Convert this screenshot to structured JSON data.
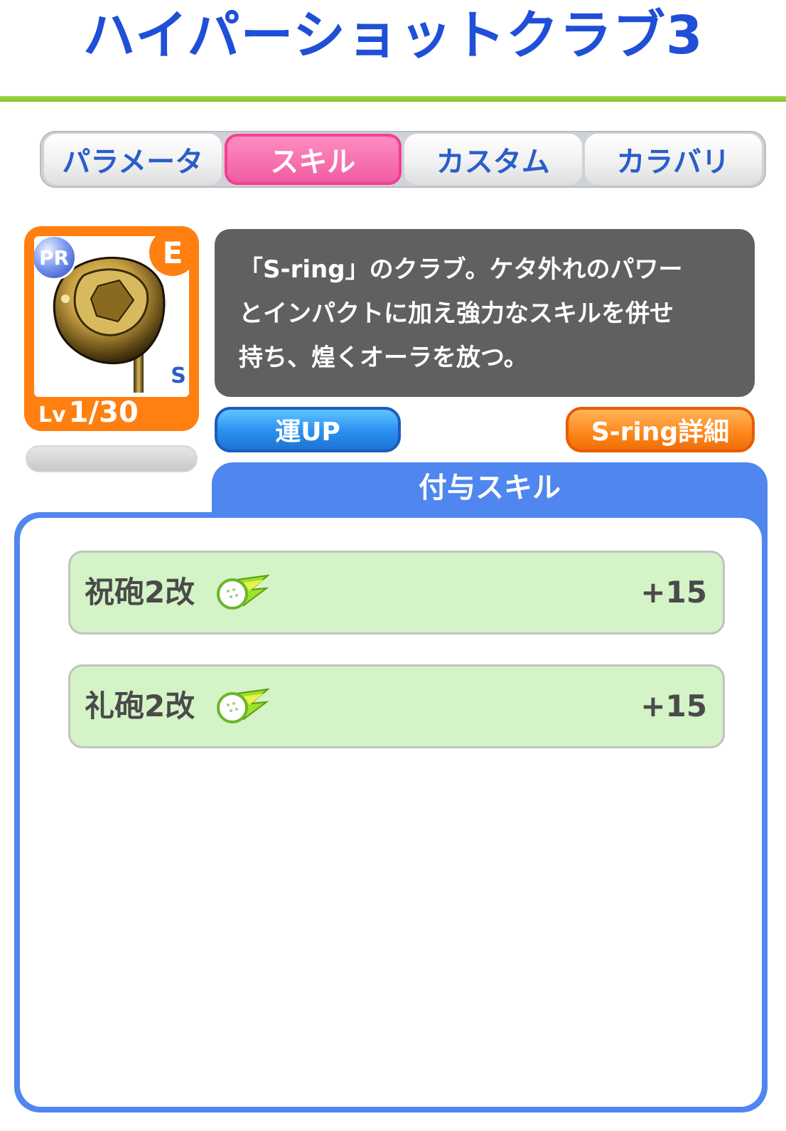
{
  "title": "ハイパーショットクラブ3",
  "tabs": [
    {
      "label": "パラメータ",
      "active": false
    },
    {
      "label": "スキル",
      "active": true
    },
    {
      "label": "カスタム",
      "active": false
    },
    {
      "label": "カラバリ",
      "active": false
    }
  ],
  "item": {
    "rarity_badge": "PR",
    "grade": "E",
    "level_prefix": "Lv",
    "level": "1/30",
    "brand_mark": "S"
  },
  "description": {
    "line1": "「S-ring」のクラブ。ケタ外れのパワー",
    "line2": "とインパクトに加え強力なスキルを併せ",
    "line3": "持ち、煌くオーラを放つ。"
  },
  "buttons": {
    "luck_up": "運UP",
    "sring_detail": "S-ring詳細"
  },
  "skills_panel": {
    "title": "付与スキル",
    "skills": [
      {
        "name": "祝砲2改",
        "icon": "golf-ball-comet-icon",
        "value": "+15"
      },
      {
        "name": "礼砲2改",
        "icon": "golf-ball-comet-icon",
        "value": "+15"
      }
    ]
  },
  "colors": {
    "title_blue": "#1f4fd6",
    "accent_green": "#8cc63f",
    "active_tab_pink": "#f05aa0",
    "card_orange": "#ff7f11",
    "panel_blue": "#4f86ef",
    "skill_row_green": "#d4f3c6"
  }
}
